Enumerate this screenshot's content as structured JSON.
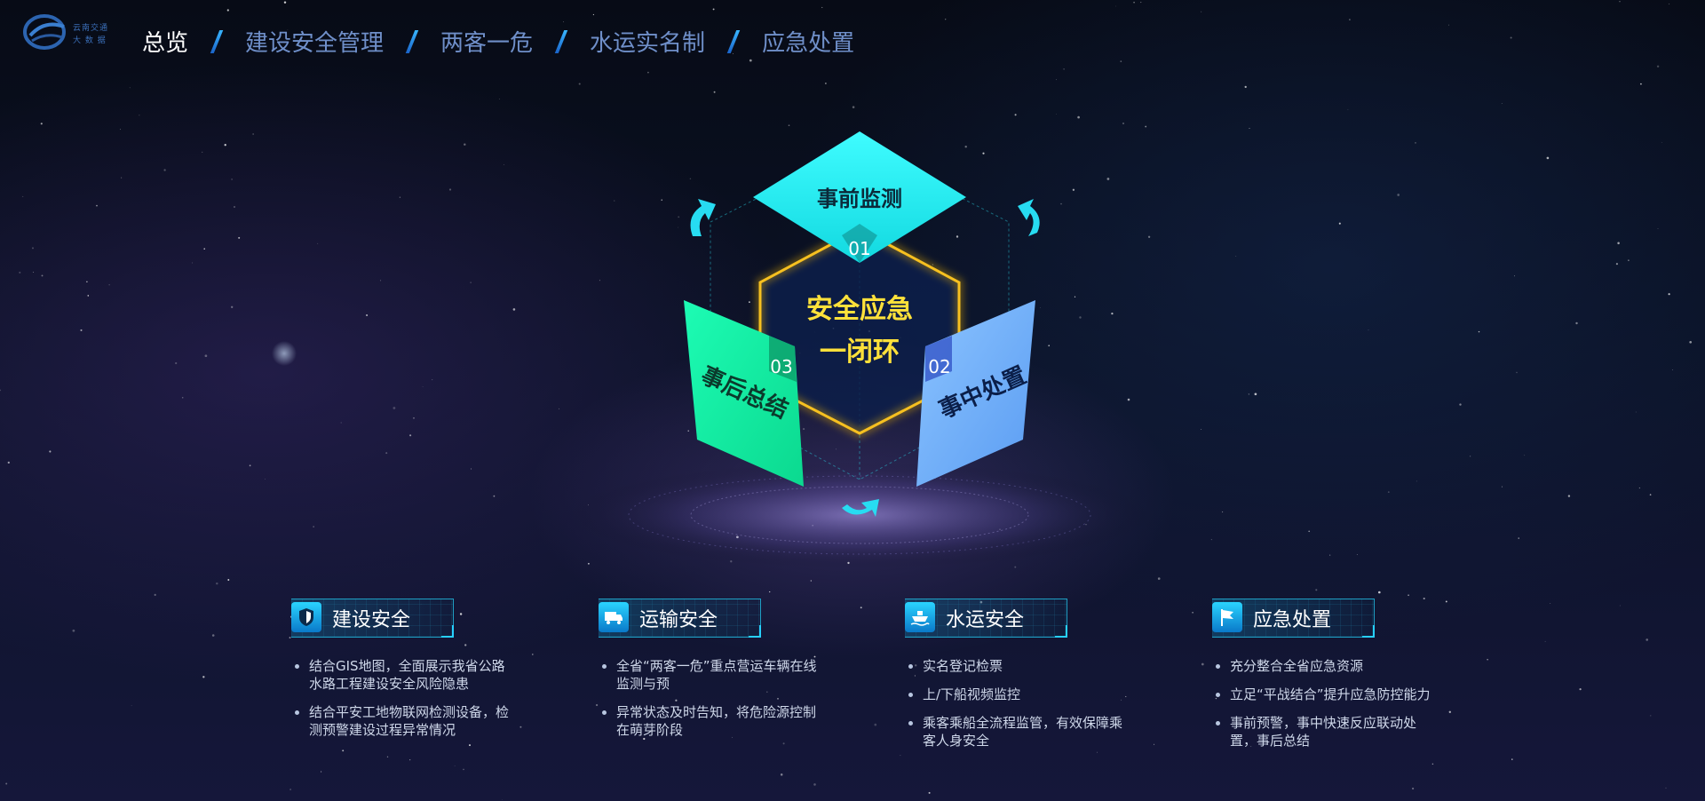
{
  "header": {
    "logo": {
      "line1": "云南交通",
      "line2": "大 数 据"
    },
    "nav": [
      {
        "label": "总览",
        "active": true
      },
      {
        "label": "建设安全管理",
        "active": false
      },
      {
        "label": "两客一危",
        "active": false
      },
      {
        "label": "水运实名制",
        "active": false
      },
      {
        "label": "应急处置",
        "active": false
      }
    ]
  },
  "cycle": {
    "center_line1": "安全应急",
    "center_line2": "一闭环",
    "top": {
      "num": "01",
      "label": "事前监测"
    },
    "right": {
      "num": "02",
      "label": "事中处置"
    },
    "left": {
      "num": "03",
      "label": "事后总结"
    },
    "colors": {
      "top": "#19f0ee",
      "right": "#7fb7ff",
      "left": "#12f2a6",
      "center_border": "#f2b400",
      "center_text": "#ffe13a"
    }
  },
  "columns": [
    {
      "icon": "shield-icon",
      "title": "建设安全",
      "items": [
        "结合GIS地图，全面展示我省公路水路工程建设安全风险隐患",
        "结合平安工地物联网检测设备，检测预警建设过程异常情况"
      ]
    },
    {
      "icon": "truck-icon",
      "title": "运输安全",
      "items": [
        "全省“两客一危”重点营运车辆在线监测与预",
        "异常状态及时告知，将危险源控制在萌芽阶段"
      ]
    },
    {
      "icon": "ship-icon",
      "title": "水运安全",
      "items": [
        "实名登记检票",
        "上/下船视频监控",
        "乘客乘船全流程监管，有效保障乘客人身安全"
      ]
    },
    {
      "icon": "flag-icon",
      "title": "应急处置",
      "items": [
        "充分整合全省应急资源",
        "立足“平战结合”提升应急防控能力",
        "事前预警，事中快速反应联动处置，事后总结"
      ]
    }
  ]
}
